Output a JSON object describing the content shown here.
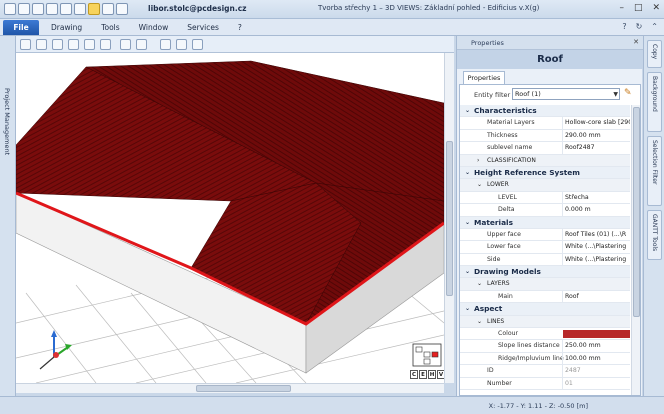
{
  "window": {
    "user_email": "libor.stolc@pcdesign.cz",
    "title": "Tvorba střechy 1 – 3D VIEWS: Základní pohled - Edificius v.X(g)",
    "controls": [
      "–",
      "□",
      "✕"
    ]
  },
  "menu": {
    "file": "File",
    "items": [
      "Drawing",
      "Tools",
      "Window",
      "Services",
      "?"
    ],
    "right_icons": [
      "?",
      "↻",
      "⌃"
    ]
  },
  "left_panel": {
    "label": "Project Management"
  },
  "properties": {
    "panel_title": "Properties",
    "object_title": "Roof",
    "tab": "Properties",
    "entity_filter_label": "Entity filter",
    "entity_filter_value": "Roof (1)",
    "rows": [
      {
        "type": "section",
        "label": "Characteristics"
      },
      {
        "type": "prop",
        "key": "Material Layers",
        "value": "Hollow-core slab [290"
      },
      {
        "type": "prop",
        "key": "Thickness",
        "value": "290.00 mm"
      },
      {
        "type": "prop",
        "key": "sublevel name",
        "value": "Roof2487"
      },
      {
        "type": "sub",
        "label": "CLASSIFICATION",
        "arrow": "›"
      },
      {
        "type": "section",
        "label": "Height Reference System"
      },
      {
        "type": "sub",
        "label": "LOWER",
        "arrow": "⌄"
      },
      {
        "type": "prop3",
        "key": "LEVEL",
        "value": "Střecha"
      },
      {
        "type": "prop3",
        "key": "Delta",
        "value": "0.000 m"
      },
      {
        "type": "section",
        "label": "Materials"
      },
      {
        "type": "prop",
        "key": "Upper face",
        "value": "Roof Tiles (01)  (...\\R"
      },
      {
        "type": "prop",
        "key": "Lower face",
        "value": "White   (...\\Plastering"
      },
      {
        "type": "prop",
        "key": "Side",
        "value": "White   (...\\Plastering"
      },
      {
        "type": "section",
        "label": "Drawing Models"
      },
      {
        "type": "sub",
        "label": "LAYERS",
        "arrow": "⌄"
      },
      {
        "type": "prop3",
        "key": "Main",
        "value": "Roof"
      },
      {
        "type": "section",
        "label": "Aspect"
      },
      {
        "type": "sub",
        "label": "LINES",
        "arrow": "⌄"
      },
      {
        "type": "colour",
        "key": "Colour",
        "value": ""
      },
      {
        "type": "prop3",
        "key": "Slope lines distance",
        "value": "250.00 mm"
      },
      {
        "type": "prop3",
        "key": "Ridge/Impluvium line",
        "value": "100.00 mm"
      },
      {
        "type": "propdim",
        "key": "ID",
        "value": "2487"
      },
      {
        "type": "propdim",
        "key": "Number",
        "value": "01"
      }
    ]
  },
  "right_tabs": [
    "Copy",
    "Background",
    "Selection Filter",
    "GANTT Tools"
  ],
  "viewcube_buttons": [
    "C",
    "E",
    "H",
    "V"
  ],
  "status": {
    "coords": "X: -1.77 - Y: 1.11 - Z: -0.50 [m]"
  },
  "colors": {
    "roof": "#7a0c0c",
    "roof_edge": "#e0161a",
    "colour_swatch": "#b7282a"
  }
}
